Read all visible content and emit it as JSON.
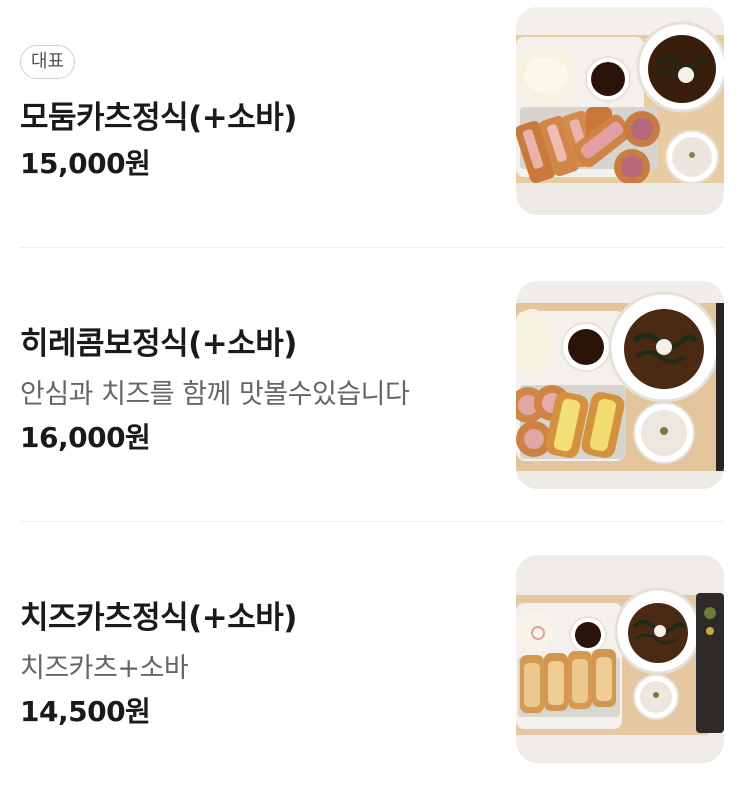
{
  "menu": {
    "items": [
      {
        "badge": "대표",
        "name": "모둠카츠정식(+소바)",
        "description": "",
        "price": "15,000원",
        "image_icon": "tonkatsu-set-photo"
      },
      {
        "badge": "",
        "name": "히레콤보정식(+소바)",
        "description": "안심과 치즈를 함께 맛볼수있습니다",
        "price": "16,000원",
        "image_icon": "tonkatsu-set-photo"
      },
      {
        "badge": "",
        "name": "치즈카츠정식(+소바)",
        "description": "치즈카츠+소바",
        "price": "14,500원",
        "image_icon": "tonkatsu-set-photo"
      }
    ]
  },
  "colors": {
    "text": "#1a1a1a",
    "subtext": "#666666",
    "divider": "#eeeeee",
    "tray_wood": "#e6c8a0",
    "katsu": "#d98a4a",
    "soba_broth": "#5a3418"
  }
}
